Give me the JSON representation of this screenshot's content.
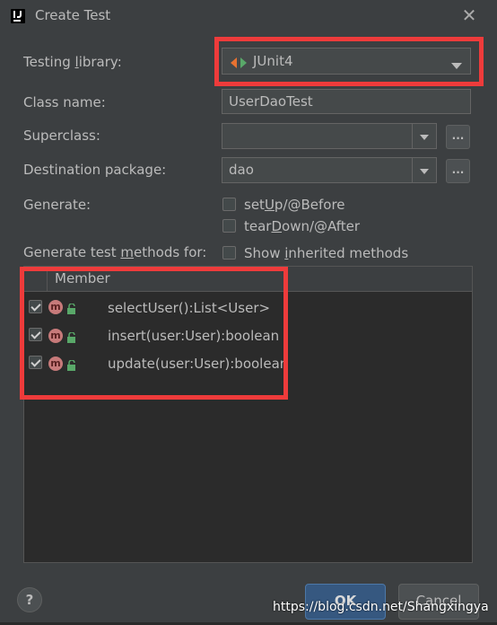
{
  "window": {
    "title": "Create Test"
  },
  "testing_library": {
    "label_pre": "Testing ",
    "label_ul": "l",
    "label_post": "ibrary:",
    "value": "JUnit4"
  },
  "class_name": {
    "label": "Class name:",
    "value": "UserDaoTest"
  },
  "superclass": {
    "label": "Superclass:",
    "value": "",
    "browse_label": "..."
  },
  "destination_package": {
    "label": "Destination package:",
    "value": "dao",
    "browse_label": "..."
  },
  "generate": {
    "label": "Generate:",
    "setup": {
      "pre": "set",
      "ul": "U",
      "post": "p/@Before",
      "checked": false
    },
    "teardown": {
      "pre": "tear",
      "ul": "D",
      "post": "own/@After",
      "checked": false
    }
  },
  "generate_methods": {
    "label_pre": "Generate test ",
    "label_ul": "m",
    "label_post": "ethods for:",
    "show_inherited": {
      "pre": "Show ",
      "ul": "i",
      "post": "nherited methods",
      "checked": false
    }
  },
  "member_table": {
    "header": "Member",
    "rows": [
      {
        "name": "selectUser():List<User>",
        "checked": true,
        "icon": "method-icon"
      },
      {
        "name": "insert(user:User):boolean",
        "checked": true,
        "icon": "method-icon"
      },
      {
        "name": "update(user:User):boolean",
        "checked": true,
        "icon": "method-icon"
      }
    ]
  },
  "footer": {
    "help_label": "?",
    "ok_label": "OK",
    "cancel_label": "Cancel"
  },
  "watermark": "https://blog.csdn.net/Shangxingya",
  "colors": {
    "background": "#3c3f41",
    "highlight": "#ee3b3b",
    "ok_button": "#365880"
  }
}
